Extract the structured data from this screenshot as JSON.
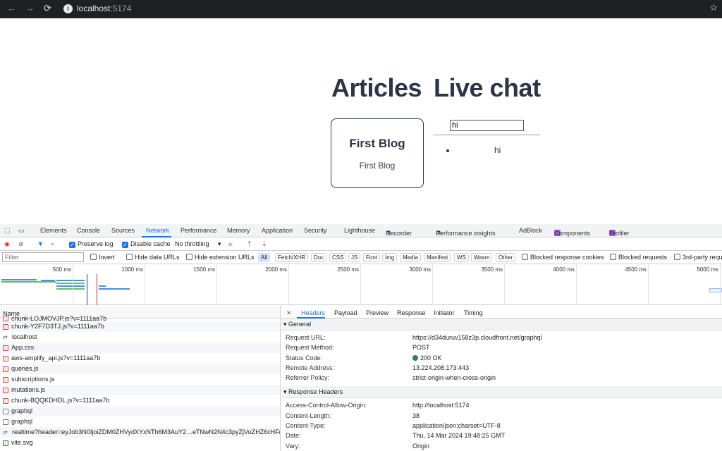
{
  "browser": {
    "url_host": "localhost",
    "url_port": ":5174"
  },
  "page": {
    "heading_articles": "Articles",
    "heading_chat": "Live chat",
    "blog_title": "First Blog",
    "blog_body": "First Blog",
    "chat_input_value": "hi",
    "chat_message": "hi"
  },
  "devtools": {
    "tabs": [
      "Elements",
      "Console",
      "Sources",
      "Network",
      "Performance",
      "Memory",
      "Application",
      "Security",
      "Lighthouse",
      "Recorder",
      "Performance insights",
      "AdBlock",
      "Components",
      "Profiler"
    ],
    "active_tab": "Network",
    "toolbar": {
      "preserve_log": "Preserve log",
      "disable_cache": "Disable cache",
      "throttling": "No throttling"
    },
    "filter": {
      "placeholder": "Filter",
      "invert": "Invert",
      "hide_data_urls": "Hide data URLs",
      "hide_extension_urls": "Hide extension URLs",
      "types": [
        "All",
        "Fetch/XHR",
        "Doc",
        "CSS",
        "JS",
        "Font",
        "Img",
        "Media",
        "Manifest",
        "WS",
        "Wasm",
        "Other"
      ],
      "selected_type": "All",
      "blocked_cookies": "Blocked response cookies",
      "blocked_requests": "Blocked requests",
      "third_party": "3rd-party requ"
    },
    "overview_ticks": [
      "500 ms",
      "1000 ms",
      "1500 ms",
      "2000 ms",
      "2500 ms",
      "3000 ms",
      "3500 ms",
      "4000 ms",
      "4500 ms",
      "5000 ms"
    ],
    "requests": {
      "column_name": "Name",
      "items": [
        {
          "name": "chunk-LOJMOVJP.js?v=1111aa7b",
          "type": "js"
        },
        {
          "name": "chunk-Y2F7D3TJ.js?v=1111aa7b",
          "type": "js"
        },
        {
          "name": "localhost",
          "type": "ws"
        },
        {
          "name": "App.css",
          "type": "js"
        },
        {
          "name": "aws-amplify_api.js?v=1111aa7b",
          "type": "js"
        },
        {
          "name": "queries.js",
          "type": "js"
        },
        {
          "name": "subscriptions.js",
          "type": "js"
        },
        {
          "name": "mutations.js",
          "type": "js"
        },
        {
          "name": "chunk-BQQKDHDL.js?v=1111aa7b",
          "type": "js"
        },
        {
          "name": "graphql",
          "type": "doc"
        },
        {
          "name": "graphql",
          "type": "doc"
        },
        {
          "name": "realtime?header=eyJob3N0IjoiZDM0ZHVydXYxNTh6M3AuY2…eTNwN2N4c3pyZjVuZHZ6cHFrb…",
          "type": "ws"
        },
        {
          "name": "vite.svg",
          "type": "svg"
        }
      ]
    },
    "details": {
      "tabs": [
        "Headers",
        "Payload",
        "Preview",
        "Response",
        "Initiator",
        "Timing"
      ],
      "active_tab": "Headers",
      "general_title": "General",
      "general": [
        {
          "key": "Request URL:",
          "value": "https://d34duruv158z3p.cloudfront.net/graphql"
        },
        {
          "key": "Request Method:",
          "value": "POST"
        },
        {
          "key": "Status Code:",
          "value": "200 OK"
        },
        {
          "key": "Remote Address:",
          "value": "13.224.208.173:443"
        },
        {
          "key": "Referrer Policy:",
          "value": "strict-origin-when-cross-origin"
        }
      ],
      "response_title": "Response Headers",
      "response": [
        {
          "key": "Access-Control-Allow-Origin:",
          "value": "http://localhost:5174"
        },
        {
          "key": "Content-Length:",
          "value": "38"
        },
        {
          "key": "Content-Type:",
          "value": "application/json;charset=UTF-8"
        },
        {
          "key": "Date:",
          "value": "Thu, 14 Mar 2024 19:48:25 GMT"
        },
        {
          "key": "Vary:",
          "value": "Origin"
        }
      ]
    }
  }
}
